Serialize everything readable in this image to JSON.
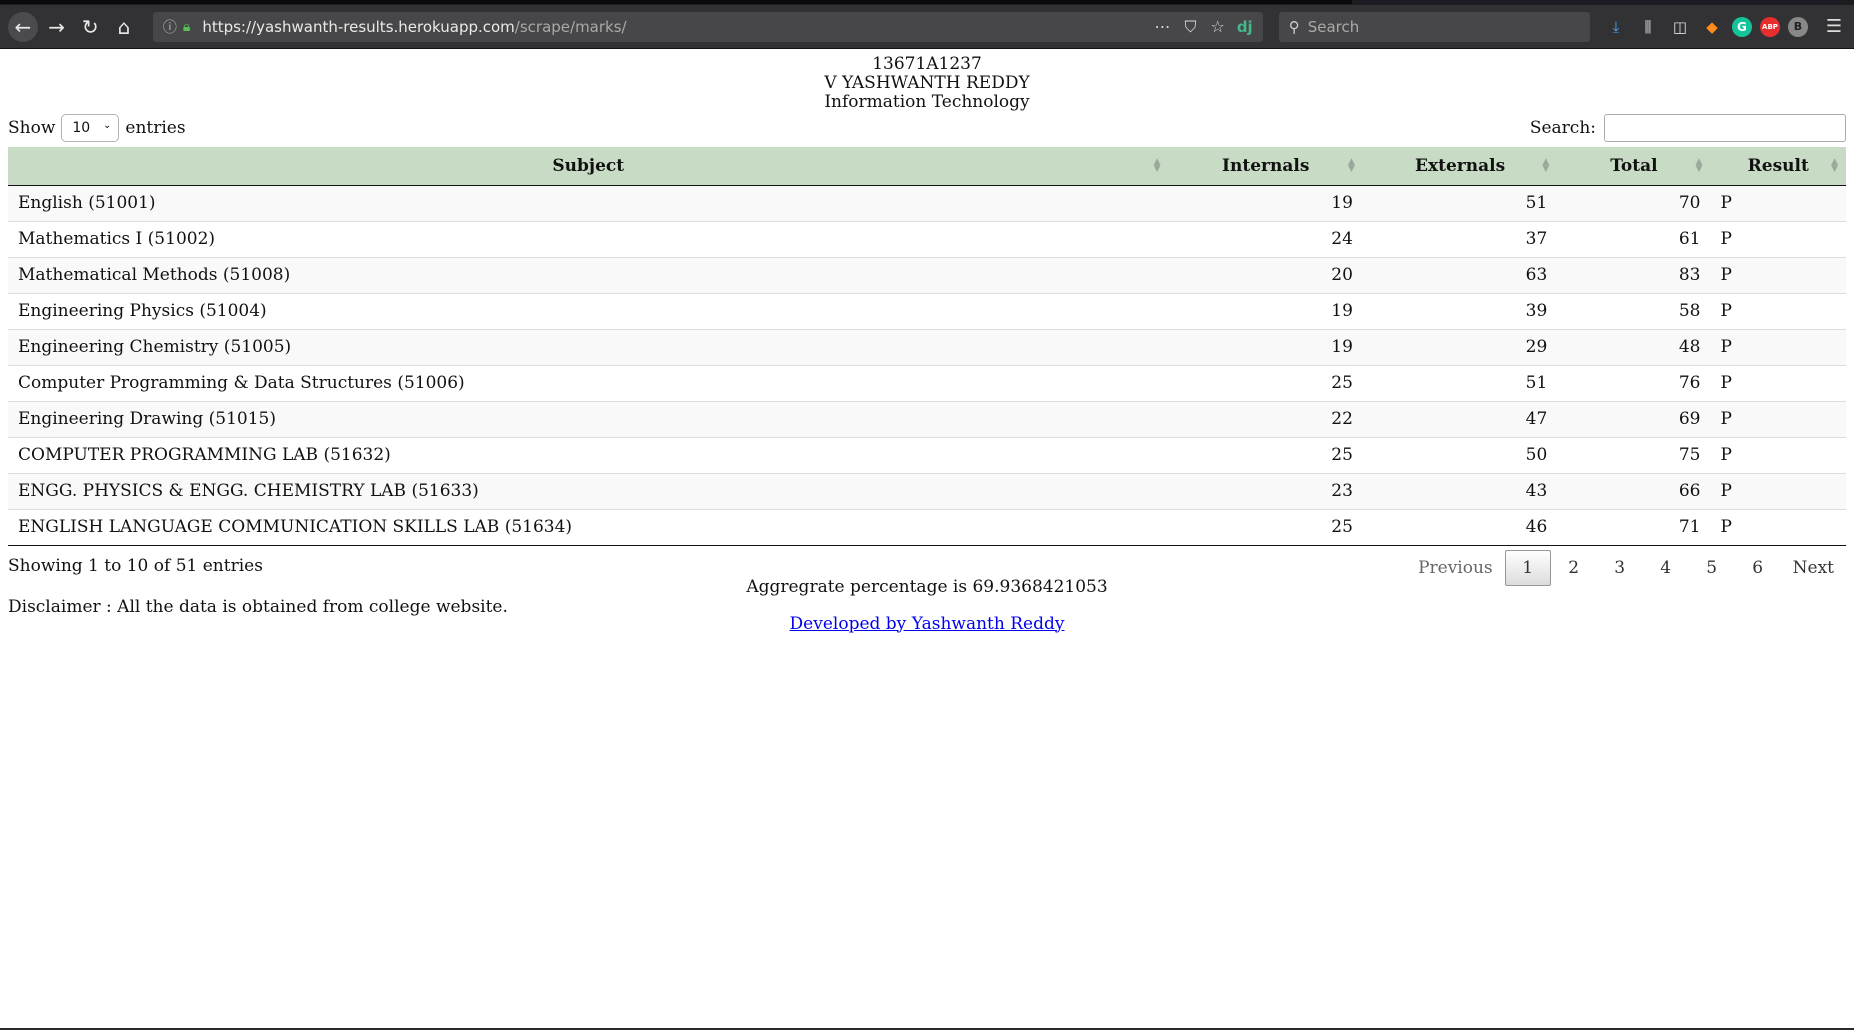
{
  "browser": {
    "url_host": "https://yashwanth-results.herokuapp.com",
    "url_path": "/scrape/marks/",
    "search_placeholder": "Search",
    "extension_grammarly": "G",
    "extension_abp": "ABP",
    "extension_b": "B",
    "extension_dj": "dj"
  },
  "student": {
    "roll_no": "13671A1237",
    "name": "V YASHWANTH REDDY",
    "branch": "Information Technology"
  },
  "controls": {
    "show_label": "Show",
    "entries_value": "10",
    "entries_label": "entries",
    "search_label": "Search:"
  },
  "table": {
    "headers": [
      "Subject",
      "Internals",
      "Externals",
      "Total",
      "Result"
    ],
    "rows": [
      {
        "subject": "English (51001)",
        "internals": "19",
        "externals": "51",
        "total": "70",
        "result": "P"
      },
      {
        "subject": "Mathematics I (51002)",
        "internals": "24",
        "externals": "37",
        "total": "61",
        "result": "P"
      },
      {
        "subject": "Mathematical Methods (51008)",
        "internals": "20",
        "externals": "63",
        "total": "83",
        "result": "P"
      },
      {
        "subject": "Engineering Physics (51004)",
        "internals": "19",
        "externals": "39",
        "total": "58",
        "result": "P"
      },
      {
        "subject": "Engineering Chemistry (51005)",
        "internals": "19",
        "externals": "29",
        "total": "48",
        "result": "P"
      },
      {
        "subject": "Computer Programming & Data Structures (51006)",
        "internals": "25",
        "externals": "51",
        "total": "76",
        "result": "P"
      },
      {
        "subject": "Engineering Drawing (51015)",
        "internals": "22",
        "externals": "47",
        "total": "69",
        "result": "P"
      },
      {
        "subject": "COMPUTER PROGRAMMING LAB (51632)",
        "internals": "25",
        "externals": "50",
        "total": "75",
        "result": "P"
      },
      {
        "subject": "ENGG. PHYSICS & ENGG. CHEMISTRY LAB (51633)",
        "internals": "23",
        "externals": "43",
        "total": "66",
        "result": "P"
      },
      {
        "subject": "ENGLISH LANGUAGE COMMUNICATION SKILLS LAB (51634)",
        "internals": "25",
        "externals": "46",
        "total": "71",
        "result": "P"
      }
    ]
  },
  "info": "Showing 1 to 10 of 51 entries",
  "pagination": {
    "previous": "Previous",
    "pages": [
      "1",
      "2",
      "3",
      "4",
      "5",
      "6"
    ],
    "current": "1",
    "next": "Next"
  },
  "aggregate": "Aggregrate percentage is 69.9368421053",
  "disclaimer": "Disclaimer : All the data is obtained from college website.",
  "developer_link": "Developed by Yashwanth Reddy"
}
